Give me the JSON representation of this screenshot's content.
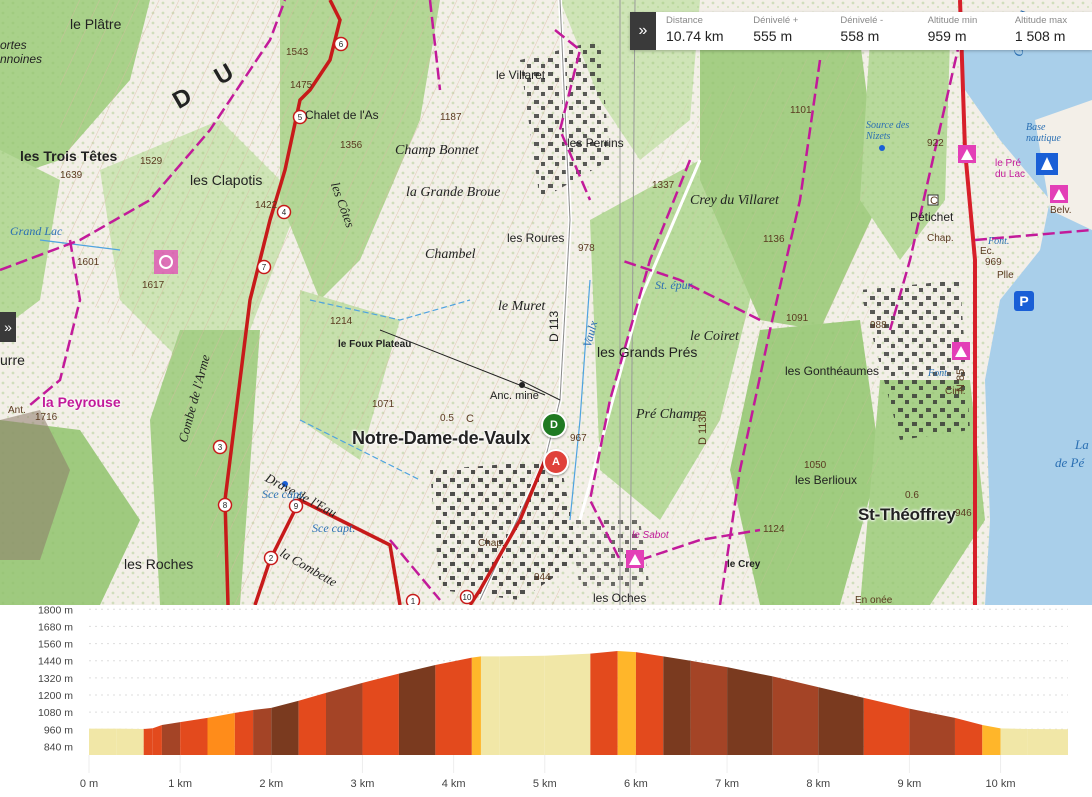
{
  "stats": {
    "toggle_icon": "»",
    "items": [
      {
        "label": "Distance",
        "value": "10.74 km"
      },
      {
        "label": "Dénivelé +",
        "value": "555 m"
      },
      {
        "label": "Dénivelé -",
        "value": "558 m"
      },
      {
        "label": "Altitude min",
        "value": "959 m"
      },
      {
        "label": "Altitude max",
        "value": "1 508 m"
      }
    ]
  },
  "side_toggle_icon": "»",
  "markers": {
    "start": "A",
    "end": "D",
    "parking": "P"
  },
  "map_labels": {
    "le_platre": "le Plâtre",
    "du": "D U",
    "portes": "ortes",
    "annoines": "nnoines",
    "trois_tetes": "les Trois Têtes",
    "clapotis": "les Clapotis",
    "grand_lac": "Grand Lac",
    "la_peyrouse": "la Peyrouse",
    "urre": "urre",
    "ant": "Ant.",
    "les_roches": "les Roches",
    "combe": "Combe de l'Arme",
    "drave": "Drave de l'Eau",
    "sce_capt": "Sce capt.",
    "sce_capt2": "Sce capt.",
    "la_combette": "la Combette",
    "chalet": "Chalet de l'As",
    "les_cotes": "les Côtes",
    "champ_bonnet": "Champ Bonnet",
    "grande_broue": "la Grande Broue",
    "chambel": "Chambel",
    "les_roures": "les Roures",
    "le_villaret": "le Villaret",
    "les_perrins": "les Perrins",
    "le_muret": "le Muret",
    "foux_plateau": "le Foux Plateau",
    "anc_mine": "Anc. mine",
    "ndv": "Notre-Dame-de-Vaulx",
    "d113": "D 113",
    "vaulx": "Vaulx",
    "les_grands_pres": "les Grands Prés",
    "pre_champ": "Pré Champ",
    "crey_villaret": "Crey du Villaret",
    "le_coiret": "le Coiret",
    "st_epur": "St. épur.",
    "les_gontheaumes": "les Gonthéaumes",
    "les_berlioux": "les Berlioux",
    "st_theoffrey": "St-Théoffrey",
    "le_crey": "le Crey",
    "le_sabot": "le Sabot",
    "les_oches": "les Oches",
    "petichet": "Pétichet",
    "chap": "Chap.",
    "font": "Font.",
    "font2": "Font.",
    "belv": "Belv.",
    "le_pre_du_lac": "le Pré du Lac",
    "base_nautique": "Base nautique",
    "source_nizets": "Source des Nizets",
    "grand_lake": "Grand",
    "de_pe": "de Pé",
    "la": "La",
    "n85": "N 85",
    "cim": "Cim.",
    "plle": "Plle",
    "ec": "Ec.",
    "d113b": "D 113b",
    "c1": "C",
    "c2": "C",
    "chape": "Chap.",
    "en_onee": "En onée",
    "alt_1543": "1543",
    "alt_1475": "1475",
    "alt_1639": "1639",
    "alt_1529": "1529",
    "alt_1601": "1601",
    "alt_1617": "1617",
    "alt_1422": "1422",
    "alt_1356": "1356",
    "alt_1187": "1187",
    "alt_1214": "1214",
    "alt_1071": "1071",
    "alt_1716": "1716",
    "alt_978": "978",
    "alt_967": "967",
    "alt_1337": "1337",
    "alt_1101": "1101",
    "alt_1136": "1136",
    "alt_1091": "1091",
    "alt_922": "922",
    "alt_969": "969",
    "alt_988": "988",
    "alt_1050": "1050",
    "alt_1124": "1124",
    "alt_946": "946",
    "alt_944": "944",
    "alt_0_5": "0.5",
    "alt_0_6": "0.6"
  },
  "route_km_markers": [
    "1",
    "2",
    "3",
    "4",
    "5",
    "6",
    "7",
    "8",
    "9",
    "10"
  ],
  "chart_data": {
    "type": "area",
    "title": "",
    "xlabel": "",
    "ylabel": "",
    "x_ticks": [
      "0 m",
      "1 km",
      "2 km",
      "3 km",
      "4 km",
      "5 km",
      "6 km",
      "7 km",
      "8 km",
      "9 km",
      "10 km"
    ],
    "y_ticks": [
      "840 m",
      "960 m",
      "1080 m",
      "1200 m",
      "1320 m",
      "1440 m",
      "1560 m",
      "1680 m",
      "1800 m"
    ],
    "xlim_km": [
      0,
      10.74
    ],
    "ylim_m": [
      780,
      1830
    ],
    "series": [
      {
        "x_km": [
          0,
          0.3,
          0.6,
          0.7,
          0.8,
          1.0,
          1.3,
          1.6,
          1.8,
          2.0,
          2.3,
          2.6,
          3.0,
          3.4,
          3.8,
          4.2,
          4.3,
          4.5,
          5.0,
          5.5,
          5.8,
          6.0,
          6.3,
          6.6,
          7.0,
          7.5,
          8.0,
          8.5,
          9.0,
          9.5,
          9.8,
          10.0,
          10.3,
          10.74
        ],
        "elevation_m": [
          965,
          965,
          962,
          967,
          990,
          1010,
          1040,
          1075,
          1095,
          1110,
          1160,
          1215,
          1285,
          1350,
          1410,
          1462,
          1470,
          1470,
          1475,
          1490,
          1508,
          1500,
          1470,
          1440,
          1395,
          1330,
          1255,
          1180,
          1105,
          1040,
          990,
          966,
          962,
          960
        ],
        "slope_colors": [
          "#f1e7a7",
          "#f1e7a7",
          "#e34a1d",
          "#e34a1d",
          "#a44426",
          "#e34a1d",
          "#ff8c1a",
          "#e34a1d",
          "#a44426",
          "#7a3a1f",
          "#e34a1d",
          "#a44426",
          "#e34a1d",
          "#7a3a1f",
          "#e34a1d",
          "#ffb62a",
          "#f1e7a7",
          "#f1e7a7",
          "#f1e7a7",
          "#e34a1d",
          "#ffb62a",
          "#e34a1d",
          "#7a3a1f",
          "#a44426",
          "#7a3a1f",
          "#a44426",
          "#7a3a1f",
          "#e34a1d",
          "#a44426",
          "#e34a1d",
          "#ffb62a",
          "#f1e7a7",
          "#f1e7a7"
        ]
      }
    ],
    "grid": "horizontal dotted"
  }
}
